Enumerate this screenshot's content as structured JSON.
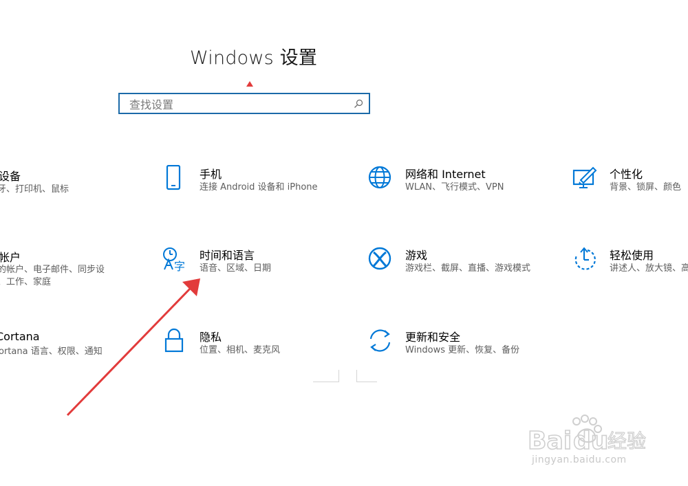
{
  "window": {
    "title": "Windows 设置"
  },
  "search": {
    "placeholder": "查找设置",
    "value": ""
  },
  "categories_left_partial": [
    {
      "name": "设备",
      "desc": [
        "牙、打印机、鼠标"
      ],
      "name_text": "设备"
    },
    {
      "name": "帐户",
      "desc": [
        "你的帐户、电子邮件、同步设",
        "、工作、家庭"
      ],
      "name_text": "帐户"
    },
    {
      "name": "Cortana",
      "desc": [
        "Cortana 语言、权限、通知"
      ],
      "name_text": "Cortana"
    }
  ],
  "left_visible": {
    "devices_name": "设备",
    "devices_desc": "牙、打印机、鼠标",
    "accounts_name": "帐户",
    "accounts_desc_1": "的帐户、电子邮件、同步设",
    "accounts_desc_2": "、工作、家庭",
    "cortana_name": "Cortana",
    "cortana_desc": "ortana 语言、权限、通知"
  },
  "categories": {
    "phone": {
      "name": "手机",
      "desc": "连接 Android 设备和 iPhone",
      "icon": "phone-icon"
    },
    "network": {
      "name": "网络和 Internet",
      "desc": "WLAN、飞行模式、VPN",
      "icon": "globe-icon"
    },
    "personalization": {
      "name": "个性化",
      "desc": "背景、锁屏、颜色",
      "icon": "personalization-icon"
    },
    "time_language": {
      "name": "时间和语言",
      "desc": "语音、区域、日期",
      "icon": "time-language-icon"
    },
    "gaming": {
      "name": "游戏",
      "desc": "游戏栏、截屏、直播、游戏模式",
      "icon": "xbox-icon"
    },
    "ease_of_access": {
      "name": "轻松使用",
      "desc": "讲述人、放大镜、高",
      "icon": "ease-of-access-icon"
    },
    "privacy": {
      "name": "隐私",
      "desc": "位置、相机、麦克风",
      "icon": "lock-icon"
    },
    "update_security": {
      "name": "更新和安全",
      "desc": "Windows 更新、恢复、备份",
      "icon": "sync-icon"
    }
  },
  "watermark": {
    "brand": "Bai du 经验",
    "url": "jingyan.baidu.com"
  },
  "colors": {
    "accent": "#0078d7",
    "arrow": "#e23b3b",
    "search_border": "#1b6aa8"
  }
}
